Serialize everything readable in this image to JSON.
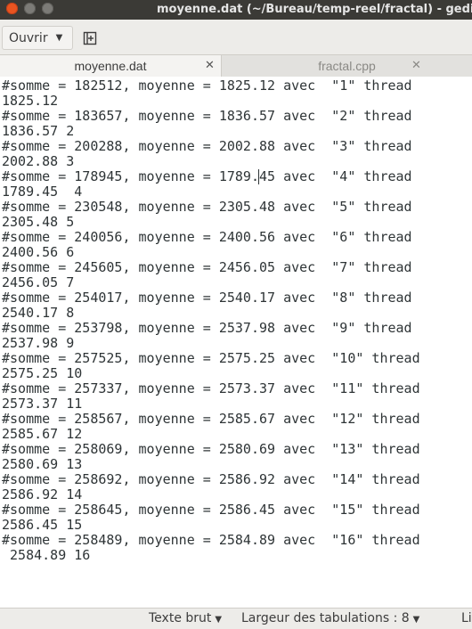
{
  "window": {
    "title": "moyenne.dat (~/Bureau/temp-reel/fractal) - gedit"
  },
  "header": {
    "open_label": "Ouvrir",
    "dropdown_icon": "caret-down-icon",
    "new_tab_icon": "new-document-icon"
  },
  "tabs": [
    {
      "label": "moyenne.dat",
      "active": true
    },
    {
      "label": "fractal.cpp",
      "active": false
    }
  ],
  "editor": {
    "lines": [
      "#somme = 182512, moyenne = 1825.12 avec  \"1\" thread",
      "1825.12",
      "#somme = 183657, moyenne = 1836.57 avec  \"2\" thread",
      "1836.57 2",
      "#somme = 200288, moyenne = 2002.88 avec  \"3\" thread",
      "2002.88 3",
      "#somme = 178945, moyenne = 1789.45 avec  \"4\" thread",
      "1789.45  4",
      "#somme = 230548, moyenne = 2305.48 avec  \"5\" thread",
      "2305.48 5",
      "#somme = 240056, moyenne = 2400.56 avec  \"6\" thread",
      "2400.56 6",
      "#somme = 245605, moyenne = 2456.05 avec  \"7\" thread",
      "2456.05 7",
      "#somme = 254017, moyenne = 2540.17 avec  \"8\" thread",
      "2540.17 8",
      "#somme = 253798, moyenne = 2537.98 avec  \"9\" thread",
      "2537.98 9",
      "#somme = 257525, moyenne = 2575.25 avec  \"10\" thread",
      "2575.25 10",
      "#somme = 257337, moyenne = 2573.37 avec  \"11\" thread",
      "2573.37 11",
      "#somme = 258567, moyenne = 2585.67 avec  \"12\" thread",
      "2585.67 12",
      "#somme = 258069, moyenne = 2580.69 avec  \"13\" thread",
      "2580.69 13",
      "#somme = 258692, moyenne = 2586.92 avec  \"14\" thread",
      "2586.92 14",
      "#somme = 258645, moyenne = 2586.45 avec  \"15\" thread",
      "2586.45 15",
      "#somme = 258489, moyenne = 2584.89 avec  \"16\" thread",
      " 2584.89 16"
    ]
  },
  "statusbar": {
    "language": "Texte brut",
    "tab_width": "Largeur des tabulations : 8",
    "position": "Li"
  },
  "colors": {
    "titlebar": "#3b3a36",
    "close_button": "#e95420",
    "headerbar": "#edece9",
    "editor_bg": "#ffffff",
    "text": "#2e3436"
  }
}
